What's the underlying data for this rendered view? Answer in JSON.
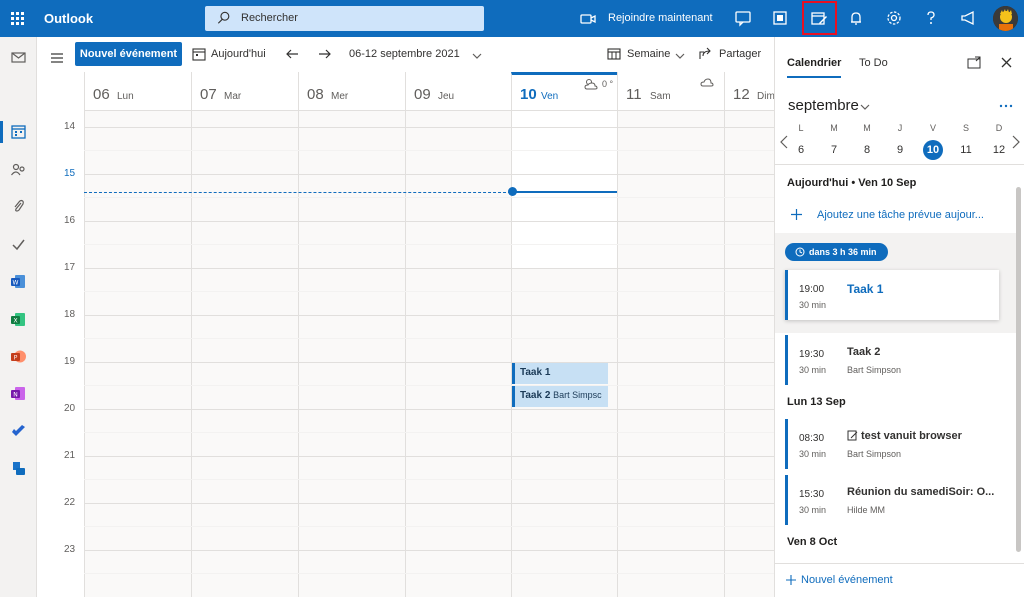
{
  "app": {
    "name": "Outlook"
  },
  "header": {
    "search_placeholder": "Rechercher",
    "join_label": "Rejoindre maintenant"
  },
  "toolbar": {
    "new_event": "Nouvel événement",
    "today": "Aujourd'hui",
    "date_range": "06-12 septembre 2021",
    "view": "Semaine",
    "share": "Partager"
  },
  "week": {
    "days": [
      {
        "num": "06",
        "name": "Lun"
      },
      {
        "num": "07",
        "name": "Mar"
      },
      {
        "num": "08",
        "name": "Mer"
      },
      {
        "num": "09",
        "name": "Jeu"
      },
      {
        "num": "10",
        "name": "Ven",
        "weather": "0 °"
      },
      {
        "num": "11",
        "name": "Sam"
      },
      {
        "num": "12",
        "name": "Dim"
      }
    ],
    "hours": [
      "14",
      "15",
      "16",
      "17",
      "18",
      "19",
      "20",
      "21",
      "22",
      "23"
    ],
    "events": [
      {
        "title": "Taak 1",
        "organizer": ""
      },
      {
        "title": "Taak 2",
        "organizer": "Bart Simpsc"
      }
    ]
  },
  "pane": {
    "tabs": [
      "Calendrier",
      "To Do"
    ],
    "month": "septembre",
    "weekday_letters": [
      "L",
      "M",
      "M",
      "J",
      "V",
      "S",
      "D"
    ],
    "day_numbers": [
      "6",
      "7",
      "8",
      "9",
      "10",
      "11",
      "12"
    ],
    "section_today": "Aujourd'hui  •  Ven 10 Sep",
    "add_task": "Ajoutez une tâche prévue aujour...",
    "badge": "dans 3 h 36 min",
    "cards": [
      {
        "time": "19:00",
        "duration": "30 min",
        "title": "Taak 1",
        "organizer": ""
      },
      {
        "time": "19:30",
        "duration": "30 min",
        "title": "Taak 2",
        "organizer": "Bart Simpson"
      },
      {
        "time": "08:30",
        "duration": "30 min",
        "title": "test vanuit browser",
        "organizer": "Bart Simpson"
      },
      {
        "time": "15:30",
        "duration": "30 min",
        "title": "Réunion du samediSoir: O...",
        "organizer": "Hilde MM"
      }
    ],
    "section_mon": "Lun 13 Sep",
    "section_oct": "Ven 8 Oct",
    "footer_new_event": "Nouvel événement"
  },
  "colors": {
    "brand": "#0f6cbd",
    "event_bg": "#c7e0f4",
    "highlight": "#e81123"
  }
}
